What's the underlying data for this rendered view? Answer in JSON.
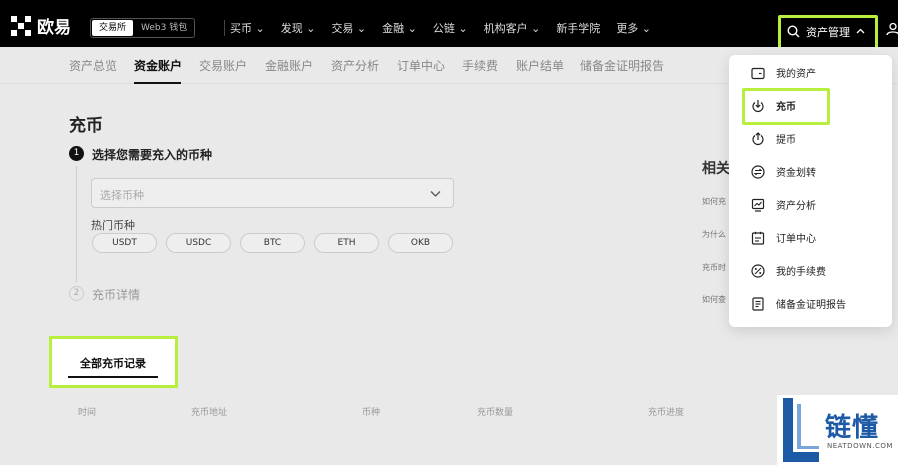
{
  "header": {
    "brand": "欧易",
    "pills": [
      "交易所",
      "Web3 钱包"
    ],
    "nav": [
      {
        "label": "买币"
      },
      {
        "label": "发现"
      },
      {
        "label": "交易"
      },
      {
        "label": "金融"
      },
      {
        "label": "公链"
      },
      {
        "label": "机构客户"
      },
      {
        "label": "新手学院"
      },
      {
        "label": "更多"
      }
    ],
    "asset_label": "资产管理"
  },
  "subnav": [
    "资产总览",
    "资金账户",
    "交易账户",
    "金融账户",
    "资产分析",
    "订单中心",
    "手续费",
    "账户结单",
    "储备金证明报告"
  ],
  "deposit": {
    "title": "充币",
    "step1_num": "1",
    "step1_label": "选择您需要充入的币种",
    "select_placeholder": "选择币种",
    "hot_label": "热门币种",
    "coins": [
      "USDT",
      "USDC",
      "BTC",
      "ETH",
      "OKB"
    ],
    "step2_num": "2",
    "step2_label": "充币详情"
  },
  "records": {
    "tab_label": "全部充币记录",
    "columns": [
      "时间",
      "充币地址",
      "币种",
      "充币数量",
      "充币进度"
    ]
  },
  "related": {
    "title": "相关",
    "items": [
      "如何充",
      "为什么",
      "充币时",
      "如何查"
    ]
  },
  "dropdown": [
    {
      "label": "我的资产",
      "icon": "wallet-icon"
    },
    {
      "label": "充币",
      "icon": "deposit-icon"
    },
    {
      "label": "提币",
      "icon": "withdraw-icon"
    },
    {
      "label": "资金划转",
      "icon": "transfer-icon"
    },
    {
      "label": "资产分析",
      "icon": "analysis-icon"
    },
    {
      "label": "订单中心",
      "icon": "order-icon"
    },
    {
      "label": "我的手续费",
      "icon": "fee-icon"
    },
    {
      "label": "储备金证明报告",
      "icon": "report-icon"
    }
  ],
  "watermark": {
    "text": "链懂",
    "sub": "NEATDOWN.COM"
  },
  "colors": {
    "highlight": "#b8ef3f",
    "topbar": "#000000",
    "watermark": "#1d5aa6"
  }
}
